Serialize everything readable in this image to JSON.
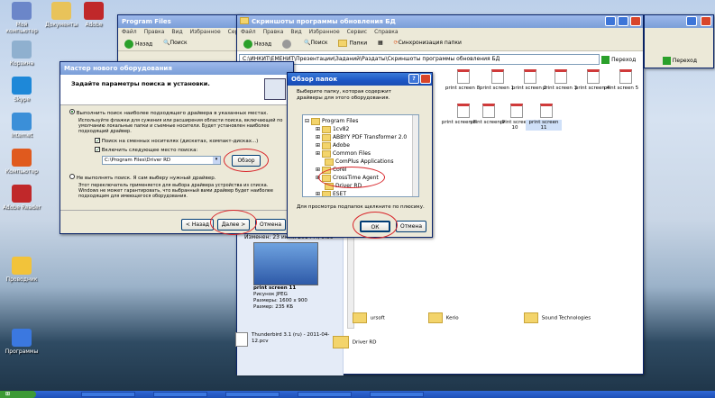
{
  "desktop": {
    "icons": [
      {
        "label": "Мой компьютер",
        "color": "#6b86c9"
      },
      {
        "label": "Документы",
        "color": "#e8c35a"
      },
      {
        "label": "Adobe",
        "color": "#c0282a"
      },
      {
        "label": "Корзина",
        "color": "#8fb0cf"
      },
      {
        "label": "Skype",
        "color": "#1e88d8"
      },
      {
        "label": "Internet",
        "color": "#3b8fd8"
      },
      {
        "label": "Компьютер",
        "color": "#e05a1e"
      },
      {
        "label": "Adobe Reader",
        "color": "#c0282a"
      },
      {
        "label": "Проводник",
        "color": "#f2c33a"
      },
      {
        "label": "Программы",
        "color": "#3b78e0"
      }
    ]
  },
  "win_program_files": {
    "title": "Program Files",
    "menu": [
      "Файл",
      "Правка",
      "Вид",
      "Избранное",
      "Сервис"
    ],
    "back": "Назад",
    "search": "Поиск"
  },
  "win_main": {
    "title": "Скриншоты программы обновления БД",
    "menu": [
      "Файл",
      "Правка",
      "Вид",
      "Избранное",
      "Сервис",
      "Справка"
    ],
    "back": "Назад",
    "search": "Поиск",
    "folders": "Папки",
    "sync": "Синхронизация папки",
    "address": "С:\\ИНКИТ\\ЕМЕНИТ\\Презентации\\Заданий\\Раздаты\\Скриншоты программы обновления БД",
    "go": "Переход",
    "files_row1": [
      "print screen 8",
      "print screen 1",
      "print screen 2",
      "print screen 3",
      "print screen 4",
      "print screen 5"
    ],
    "files_row2": [
      "print screen 8",
      "print screen 9",
      "print screen 10",
      "print screen 11"
    ],
    "modified": "Изменен: 23 июля 2014 г., 9:59",
    "detail": {
      "name": "print screen 11",
      "type": "Рисунок JPEG",
      "dims": "Размеры: 1600 x 900",
      "size": "Размер: 235 КБ"
    },
    "bottom_items": [
      "Thunderbird 3.1 (ru) - 2011-04-12.pcv",
      "Driver RD",
      "ursoft",
      "Kerio",
      "Sound Technologies"
    ]
  },
  "wizard": {
    "title": "Мастер нового оборудования",
    "heading": "Задайте параметры поиска и установки.",
    "opt1": "Выполнить поиск наиболее подходящего драйвера в указанных местах.",
    "opt1_desc": "Используйте флажки для сужения или расширения области поиска, включающей по умолчанию локальные папки и съемные носители. Будет установлен наиболее подходящий драйвер.",
    "chk1": "Поиск на сменных носителях (дискетах, компакт-дисках...)",
    "chk2": "Включить следующее место поиска:",
    "path": "C:\\Program Files\\Driver RD",
    "browse": "Обзор",
    "opt2": "Не выполнять поиск. Я сам выберу нужный драйвер.",
    "opt2_desc": "Этот переключатель применяется для выбора драйвера устройства из списка. Windows не может гарантировать, что выбранный вами драйвер будет наиболее подходящим для имеющегося оборудования.",
    "back": "< Назад",
    "next": "Далее >",
    "cancel": "Отмена"
  },
  "browse": {
    "title": "Обзор папок",
    "prompt": "Выберите папку, которая содержит драйверы для этого оборудования.",
    "tree": [
      "Program Files",
      "1cv82",
      "ABBYY PDF Transformer 2.0",
      "Adobe",
      "Common Files",
      "ComPlus Applications",
      "Corel",
      "CrossTime Agent",
      "Driver RD",
      "ESET"
    ],
    "hint": "Для просмотра подпапок щелкните по плюсику.",
    "ok": "ОК",
    "cancel": "Отмена"
  },
  "colors": {
    "annotation": "#d8252a",
    "titlebar": "#1c56c4"
  }
}
